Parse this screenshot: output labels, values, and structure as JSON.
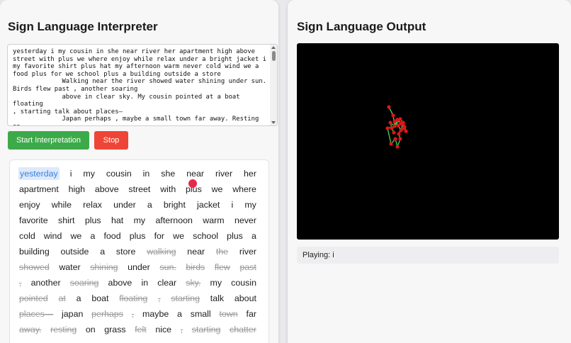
{
  "left_panel": {
    "title": "Sign Language Interpreter",
    "textarea_text": "yesterday i my cousin in she near river her apartment high above street with plus we where enjoy while relax under a bright jacket i my favorite shirt plus hat my afternoon warm never cold wind we a food plus for we school plus a building outside a store\n             Walking near the river showed water shining under sun.\nBirds flew past , another soaring\n             above in clear sky. My cousin pointed at a boat floating\n, starting talk about places—\n             Japan perhaps , maybe a small town far away. Resting on\ngrass felt nice , starting\n             chatter about everything. She explained her library work",
    "start_button": "Start Interpretation",
    "stop_button": "Stop",
    "word_lines": [
      [
        {
          "t": "yesterday",
          "s": "cur"
        },
        {
          "t": "i",
          "s": "ok"
        },
        {
          "t": "my",
          "s": "ok"
        },
        {
          "t": "cousin",
          "s": "ok"
        },
        {
          "t": "in",
          "s": "ok"
        },
        {
          "t": "she",
          "s": "ok"
        },
        {
          "t": "near",
          "s": "ok"
        },
        {
          "t": "river",
          "s": "ok"
        },
        {
          "t": "her",
          "s": "ok"
        }
      ],
      [
        {
          "t": "apartment",
          "s": "ok"
        },
        {
          "t": "high",
          "s": "ok"
        },
        {
          "t": "above",
          "s": "ok"
        },
        {
          "t": "street",
          "s": "ok"
        },
        {
          "t": "with",
          "s": "ok"
        },
        {
          "t": "plus",
          "s": "ok"
        },
        {
          "t": "we",
          "s": "ok"
        },
        {
          "t": "where",
          "s": "ok"
        }
      ],
      [
        {
          "t": "enjoy",
          "s": "ok"
        },
        {
          "t": "while",
          "s": "ok"
        },
        {
          "t": "relax",
          "s": "ok"
        },
        {
          "t": "under",
          "s": "ok"
        },
        {
          "t": "a",
          "s": "ok"
        },
        {
          "t": "bright",
          "s": "ok"
        },
        {
          "t": "jacket",
          "s": "ok"
        },
        {
          "t": "i",
          "s": "ok"
        },
        {
          "t": "my",
          "s": "ok"
        }
      ],
      [
        {
          "t": "favorite",
          "s": "ok"
        },
        {
          "t": "shirt",
          "s": "ok"
        },
        {
          "t": "plus",
          "s": "ok"
        },
        {
          "t": "hat",
          "s": "ok"
        },
        {
          "t": "my",
          "s": "ok"
        },
        {
          "t": "afternoon",
          "s": "ok"
        },
        {
          "t": "warm",
          "s": "ok"
        },
        {
          "t": "never",
          "s": "ok"
        }
      ],
      [
        {
          "t": "cold",
          "s": "ok"
        },
        {
          "t": "wind",
          "s": "ok"
        },
        {
          "t": "we",
          "s": "ok"
        },
        {
          "t": "a",
          "s": "ok"
        },
        {
          "t": "food",
          "s": "ok"
        },
        {
          "t": "plus",
          "s": "ok"
        },
        {
          "t": "for",
          "s": "ok"
        },
        {
          "t": "we",
          "s": "ok"
        },
        {
          "t": "school",
          "s": "ok"
        },
        {
          "t": "plus",
          "s": "ok"
        },
        {
          "t": "a",
          "s": "ok"
        }
      ],
      [
        {
          "t": "building",
          "s": "ok"
        },
        {
          "t": "outside",
          "s": "ok"
        },
        {
          "t": "a",
          "s": "ok"
        },
        {
          "t": "store",
          "s": "ok"
        },
        {
          "t": "walking",
          "s": "skip"
        },
        {
          "t": "near",
          "s": "ok"
        },
        {
          "t": "the",
          "s": "skip"
        },
        {
          "t": "river",
          "s": "ok"
        }
      ],
      [
        {
          "t": "showed",
          "s": "skip"
        },
        {
          "t": "water",
          "s": "ok"
        },
        {
          "t": "shining",
          "s": "skip"
        },
        {
          "t": "under",
          "s": "ok"
        },
        {
          "t": "sun.",
          "s": "skip"
        },
        {
          "t": "birds",
          "s": "skip"
        },
        {
          "t": "flew",
          "s": "skip"
        },
        {
          "t": "past",
          "s": "skip"
        }
      ],
      [
        {
          "t": ",",
          "s": "skip"
        },
        {
          "t": "another",
          "s": "ok"
        },
        {
          "t": "soaring",
          "s": "skip"
        },
        {
          "t": "above",
          "s": "ok"
        },
        {
          "t": "in",
          "s": "ok"
        },
        {
          "t": "clear",
          "s": "ok"
        },
        {
          "t": "sky.",
          "s": "skip"
        },
        {
          "t": "my",
          "s": "ok"
        },
        {
          "t": "cousin",
          "s": "ok"
        }
      ],
      [
        {
          "t": "pointed",
          "s": "skip"
        },
        {
          "t": "at",
          "s": "skip"
        },
        {
          "t": "a",
          "s": "ok"
        },
        {
          "t": "boat",
          "s": "ok"
        },
        {
          "t": "floating",
          "s": "skip"
        },
        {
          "t": ",",
          "s": "skip"
        },
        {
          "t": "starting",
          "s": "skip"
        },
        {
          "t": "talk",
          "s": "ok"
        },
        {
          "t": "about",
          "s": "ok"
        }
      ],
      [
        {
          "t": "places—",
          "s": "skip"
        },
        {
          "t": "japan",
          "s": "ok"
        },
        {
          "t": "perhaps",
          "s": "skip"
        },
        {
          "t": ",",
          "s": "skip"
        },
        {
          "t": "maybe",
          "s": "ok"
        },
        {
          "t": "a",
          "s": "ok"
        },
        {
          "t": "small",
          "s": "ok"
        },
        {
          "t": "town",
          "s": "skip"
        },
        {
          "t": "far",
          "s": "ok"
        }
      ],
      [
        {
          "t": "away.",
          "s": "skip"
        },
        {
          "t": "resting",
          "s": "skip"
        },
        {
          "t": "on",
          "s": "ok"
        },
        {
          "t": "grass",
          "s": "ok"
        },
        {
          "t": "felt",
          "s": "skip"
        },
        {
          "t": "nice",
          "s": "ok"
        },
        {
          "t": ",",
          "s": "skip"
        },
        {
          "t": "starting",
          "s": "skip"
        },
        {
          "t": "chatter",
          "s": "skip"
        }
      ]
    ]
  },
  "right_panel": {
    "title": "Sign Language Output",
    "playing_label": "Playing: i"
  },
  "colors": {
    "start_button": "#3daa4a",
    "stop_button": "#ef4536",
    "current_word_bg": "#dceafb",
    "current_word_text": "#3b7fd9",
    "skipped_word": "#9a9a9a",
    "hand_bones": "#2fd15a",
    "hand_joints": "#e01414"
  }
}
